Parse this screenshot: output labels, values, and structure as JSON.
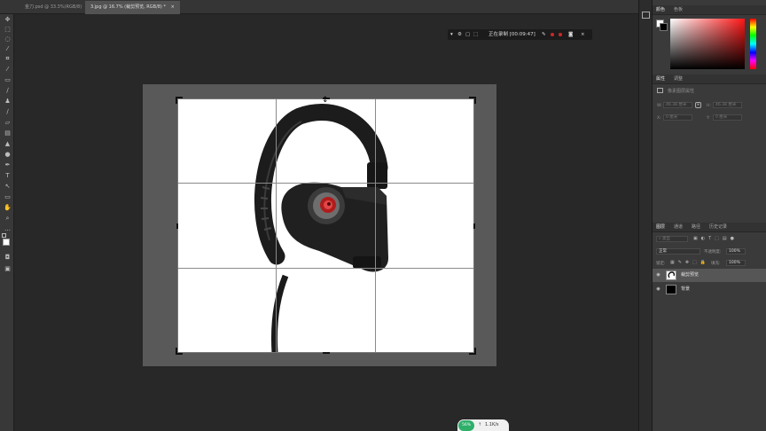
{
  "tabs": [
    {
      "label": "金刀.psd @ 33.3%(RGB/8)",
      "close": "×"
    },
    {
      "label": "3.jpg @ 16.7% (裁剪预览, RGB/8) *",
      "close": "×"
    }
  ],
  "recording": {
    "status": "正在录制 [00:09:47]"
  },
  "color_panel": {
    "tab_active": "颜色",
    "tab_other": "色板"
  },
  "properties_panel": {
    "tab_active": "属性",
    "tab_other": "调整",
    "subtitle": "像素图层属性",
    "w_label": "W:",
    "w_value": "46.38 厘米",
    "h_label": "H:",
    "h_value": "46.38 厘米",
    "x_label": "X:",
    "x_value": "0 厘米",
    "y_label": "Y:",
    "y_value": "0 厘米"
  },
  "layers_panel": {
    "tabs": [
      "图层",
      "通道",
      "路径",
      "历史记录"
    ],
    "filter_label": "类型",
    "blend_mode": "正常",
    "opacity_label": "不透明度:",
    "opacity_value": "100%",
    "lock_label": "锁定:",
    "fill_label": "填充:",
    "fill_value": "100%",
    "layers": [
      {
        "name": "裁剪预览",
        "visible": true,
        "selected": true
      },
      {
        "name": "背景",
        "visible": true,
        "selected": false
      }
    ]
  },
  "taskbar_widget": {
    "percent": "56%",
    "speed": "1.1K/s"
  },
  "colors": {
    "accent": "#c8282a",
    "panel": "#3a3a3a",
    "canvas": "#282828"
  }
}
